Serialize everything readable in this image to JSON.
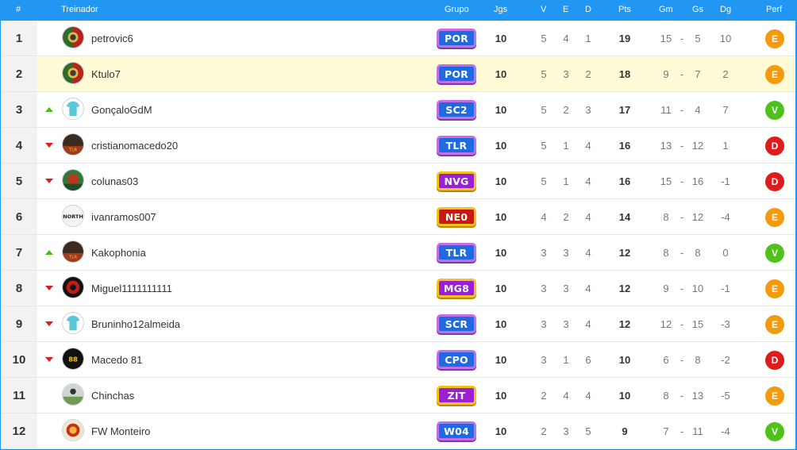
{
  "header": {
    "rank": "#",
    "coach": "Treinador",
    "group": "Grupo",
    "games": "Jgs",
    "wins": "V",
    "draws": "E",
    "losses": "D",
    "points": "Pts",
    "goals_for": "Gm",
    "goals_against": "Gs",
    "goal_diff": "Dg",
    "performance": "Perf"
  },
  "rows": [
    {
      "rank": "1",
      "trend": "none",
      "name": "petrovic6",
      "avatar": "portugal-crest",
      "group": "POR",
      "group_style": "blue",
      "games": "10",
      "v": "5",
      "e": "4",
      "d": "1",
      "pts": "19",
      "gm": "15",
      "sep": "-",
      "gs": "5",
      "dg": "10",
      "perf": "E"
    },
    {
      "rank": "2",
      "trend": "none",
      "name": "Ktulo7",
      "avatar": "portugal-crest",
      "group": "POR",
      "group_style": "blue",
      "games": "10",
      "v": "5",
      "e": "3",
      "d": "2",
      "pts": "18",
      "gm": "9",
      "sep": "-",
      "gs": "7",
      "dg": "2",
      "perf": "E",
      "highlight": true
    },
    {
      "rank": "3",
      "trend": "up",
      "name": "GonçaloGdM",
      "avatar": "jersey-cyan",
      "group": "SC2",
      "group_style": "blue",
      "games": "10",
      "v": "5",
      "e": "2",
      "d": "3",
      "pts": "17",
      "gm": "11",
      "sep": "-",
      "gs": "4",
      "dg": "7",
      "perf": "V"
    },
    {
      "rank": "4",
      "trend": "down",
      "name": "cristianomacedo20",
      "avatar": "team-badge-dark",
      "group": "TLR",
      "group_style": "blue",
      "games": "10",
      "v": "5",
      "e": "1",
      "d": "4",
      "pts": "16",
      "gm": "13",
      "sep": "-",
      "gs": "12",
      "dg": "1",
      "perf": "D"
    },
    {
      "rank": "5",
      "trend": "down",
      "name": "colunas03",
      "avatar": "team-badge-green",
      "group": "NVG",
      "group_style": "purple",
      "games": "10",
      "v": "5",
      "e": "1",
      "d": "4",
      "pts": "16",
      "gm": "15",
      "sep": "-",
      "gs": "16",
      "dg": "-1",
      "perf": "D"
    },
    {
      "rank": "6",
      "trend": "none",
      "name": "ivanramos007",
      "avatar": "north-logo",
      "group": "NE0",
      "group_style": "red",
      "games": "10",
      "v": "4",
      "e": "2",
      "d": "4",
      "pts": "14",
      "gm": "8",
      "sep": "-",
      "gs": "12",
      "dg": "-4",
      "perf": "E"
    },
    {
      "rank": "7",
      "trend": "up",
      "name": "Kakophonia",
      "avatar": "team-badge-dark",
      "group": "TLR",
      "group_style": "blue",
      "games": "10",
      "v": "3",
      "e": "3",
      "d": "4",
      "pts": "12",
      "gm": "8",
      "sep": "-",
      "gs": "8",
      "dg": "0",
      "perf": "V"
    },
    {
      "rank": "8",
      "trend": "down",
      "name": "Miguel1111111111",
      "avatar": "team-badge-red",
      "group": "MG8",
      "group_style": "purple",
      "games": "10",
      "v": "3",
      "e": "3",
      "d": "4",
      "pts": "12",
      "gm": "9",
      "sep": "-",
      "gs": "10",
      "dg": "-1",
      "perf": "E"
    },
    {
      "rank": "9",
      "trend": "down",
      "name": "Bruninho12almeida",
      "avatar": "jersey-cyan",
      "group": "SCR",
      "group_style": "blue",
      "games": "10",
      "v": "3",
      "e": "3",
      "d": "4",
      "pts": "12",
      "gm": "12",
      "sep": "-",
      "gs": "15",
      "dg": "-3",
      "perf": "E"
    },
    {
      "rank": "10",
      "trend": "down",
      "name": "Macedo 81",
      "avatar": "team-badge-yellow",
      "group": "CPO",
      "group_style": "blue",
      "games": "10",
      "v": "3",
      "e": "1",
      "d": "6",
      "pts": "10",
      "gm": "6",
      "sep": "-",
      "gs": "8",
      "dg": "-2",
      "perf": "D"
    },
    {
      "rank": "11",
      "trend": "none",
      "name": "Chinchas",
      "avatar": "player-photo",
      "group": "ZIT",
      "group_style": "purple",
      "games": "10",
      "v": "2",
      "e": "4",
      "d": "4",
      "pts": "10",
      "gm": "8",
      "sep": "-",
      "gs": "13",
      "dg": "-5",
      "perf": "E"
    },
    {
      "rank": "12",
      "trend": "none",
      "name": "FW Monteiro",
      "avatar": "club-crest-red",
      "group": "W04",
      "group_style": "blue",
      "games": "10",
      "v": "2",
      "e": "3",
      "d": "5",
      "pts": "9",
      "gm": "7",
      "sep": "-",
      "gs": "11",
      "dg": "-4",
      "perf": "V"
    }
  ],
  "colors": {
    "header_bg": "#2196f3",
    "highlight_row": "#fffbd6",
    "perf_E": "#f39a0f",
    "perf_V": "#4fc11b",
    "perf_D": "#e01b1b",
    "trend_up": "#4cbb17",
    "trend_down": "#e01b1b"
  }
}
